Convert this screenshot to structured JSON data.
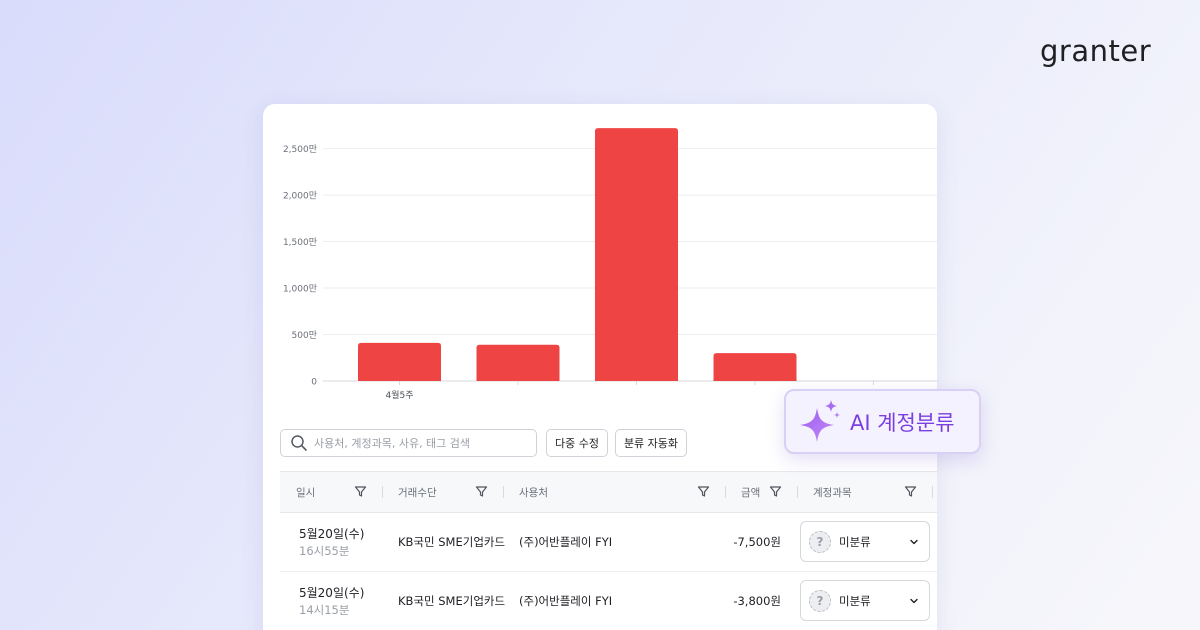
{
  "brand": {
    "logo": "granter"
  },
  "chart_data": {
    "type": "bar",
    "categories": [
      "4월5주",
      "",
      "",
      "",
      ""
    ],
    "values": [
      410,
      390,
      2720,
      300,
      0
    ],
    "bar_color": "#ef4444",
    "yticks": [
      "0",
      "500만",
      "1,000만",
      "1,500만",
      "2,000만",
      "2,500만"
    ],
    "ytick_values": [
      0,
      500,
      1000,
      1500,
      2000,
      2500
    ],
    "ylim": [
      0,
      2800
    ],
    "grid": true
  },
  "toolbar": {
    "search_placeholder": "사용처, 계정과목, 사유, 태그 검색",
    "multi_edit_label": "다중 수정",
    "auto_classify_label": "분류 자동화"
  },
  "table": {
    "headers": {
      "date": "일시",
      "method": "거래수단",
      "merchant": "사용처",
      "amount": "금액",
      "account": "계정과목"
    },
    "rows": [
      {
        "date": "5월20일(수)",
        "time": "16시55분",
        "method": "KB국민 SME기업카드",
        "merchant": "(주)어반플레이 FYI",
        "amount": "-7,500원",
        "account": "미분류"
      },
      {
        "date": "5월20일(수)",
        "time": "14시15분",
        "method": "KB국민 SME기업카드",
        "merchant": "(주)어반플레이 FYI",
        "amount": "-3,800원",
        "account": "미분류"
      }
    ]
  },
  "ai_badge": {
    "label": "AI 계정분류",
    "accent": "#7b3fe0"
  }
}
